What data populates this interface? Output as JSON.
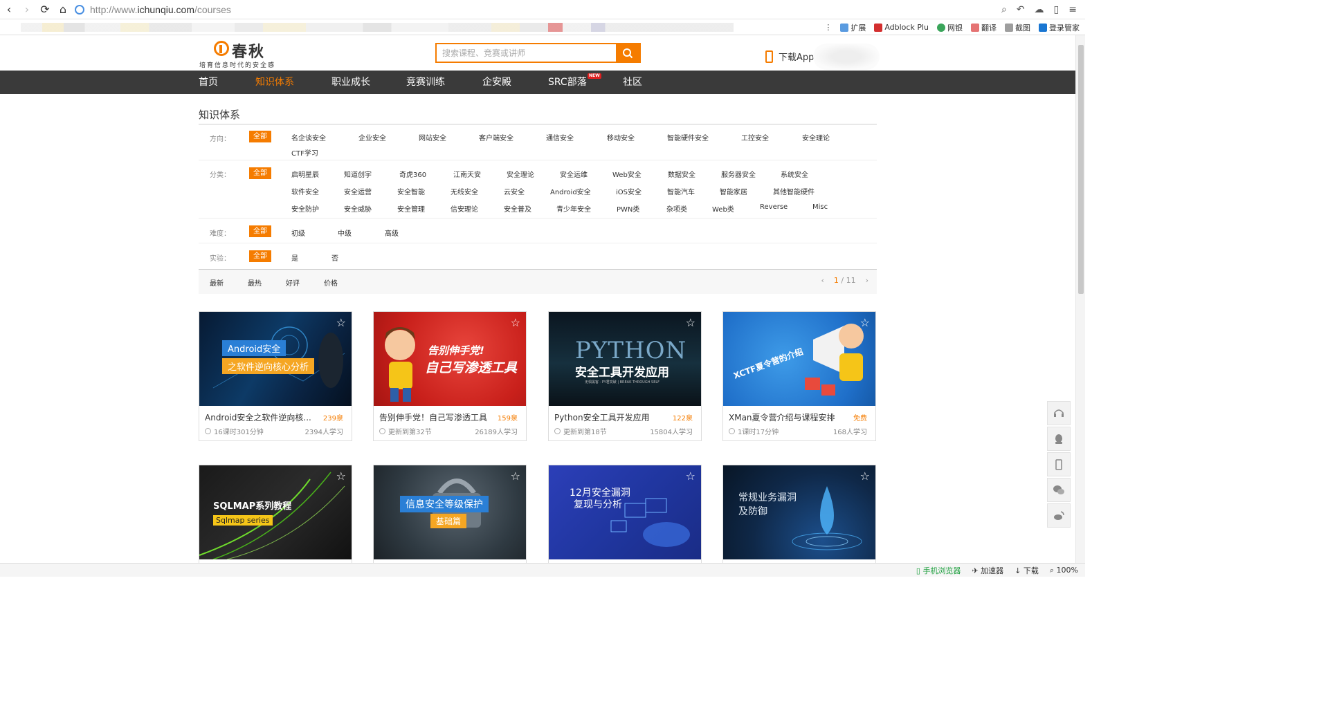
{
  "browser": {
    "url_prefix": "http://www.",
    "url_domain": "ichunqiu.com",
    "url_path": "/courses",
    "bookmarks_right": [
      "扩展",
      "Adblock Plu",
      "网银",
      "翻译",
      "截图",
      "登录管家"
    ]
  },
  "header": {
    "logo_name": "春秋",
    "logo_slogan": "培育信息时代的安全感",
    "search_placeholder": "搜索课程、竞赛或讲师",
    "download_app": "下载App"
  },
  "nav": {
    "items": [
      {
        "label": "首页",
        "active": false
      },
      {
        "label": "知识体系",
        "active": true
      },
      {
        "label": "职业成长",
        "active": false
      },
      {
        "label": "竞赛训练",
        "active": false
      },
      {
        "label": "企安殿",
        "active": false
      },
      {
        "label": "SRC部落",
        "active": false
      },
      {
        "label": "社区",
        "active": false
      }
    ],
    "new_badge": "NEW"
  },
  "page_title": "知识体系",
  "filters": {
    "direction": {
      "label": "方向：",
      "all": "全部",
      "options": [
        "名企谈安全",
        "企业安全",
        "网站安全",
        "客户端安全",
        "通信安全",
        "移动安全",
        "智能硬件安全",
        "工控安全",
        "安全理论",
        "CTF学习"
      ]
    },
    "category": {
      "label": "分类：",
      "all": "全部",
      "row1": [
        "启明星辰",
        "知道创宇",
        "奇虎360",
        "江南天安",
        "安全理论",
        "安全运维",
        "Web安全",
        "数据安全",
        "服务器安全",
        "系统安全"
      ],
      "row2": [
        "软件安全",
        "安全运营",
        "安全智能",
        "无线安全",
        "云安全",
        "Android安全",
        "iOS安全",
        "智能汽车",
        "智能家居",
        "其他智能硬件"
      ],
      "row3": [
        "安全防护",
        "安全威胁",
        "安全管理",
        "信安理论",
        "安全普及",
        "青少年安全",
        "PWN类",
        "杂项类",
        "Web类",
        "Reverse",
        "Misc"
      ]
    },
    "difficulty": {
      "label": "难度：",
      "all": "全部",
      "options": [
        "初级",
        "中级",
        "高级"
      ]
    },
    "lab": {
      "label": "实验：",
      "all": "全部",
      "options": [
        "是",
        "否"
      ]
    }
  },
  "sort": {
    "options": [
      "最新",
      "最热",
      "好评",
      "价格"
    ],
    "page_current": "1",
    "page_total": "/ 11"
  },
  "courses": [
    {
      "title": "Android安全之软件逆向核...",
      "price": "239泉",
      "meta_left": "16课时301分钟",
      "meta_right": "2394人学习",
      "thumb_line1": "Android安全",
      "thumb_line2": "之软件逆向核心分析"
    },
    {
      "title": "告别伸手党！自己写渗透工具",
      "price": "159泉",
      "meta_left": "更新到第32节",
      "meta_right": "26189人学习",
      "thumb_line1": "告别伸手党!",
      "thumb_line2": "自己写渗透工具"
    },
    {
      "title": "Python安全工具开发应用",
      "price": "122泉",
      "meta_left": "更新到第18节",
      "meta_right": "15804人学习",
      "thumb_line1": "PYTHON",
      "thumb_line2": "安全工具开发应用",
      "thumb_line3": "无惧黑客 · PY君突破 | BREAK THROUGH SELF"
    },
    {
      "title": "XMan夏令营介绍与课程安排",
      "price": "免费",
      "meta_left": "1课时17分钟",
      "meta_right": "168人学习",
      "thumb_line1": "XCTF夏令营的介绍"
    },
    {
      "thumb_line1": "SQLMAP系列教程",
      "thumb_line2": "Sqlmap series"
    },
    {
      "thumb_line1": "信息安全等级保护",
      "thumb_line2": "基础篇"
    },
    {
      "thumb_line1": "12月安全漏洞",
      "thumb_line2": "复现与分析"
    },
    {
      "thumb_line1": "常规业务漏洞",
      "thumb_line2": "及防御"
    }
  ],
  "status_bar": {
    "items": [
      "手机浏览器",
      "加速器",
      "下载",
      "100%"
    ]
  },
  "colors": {
    "accent": "#f57c00",
    "nav_bg": "#3a3a3a"
  }
}
